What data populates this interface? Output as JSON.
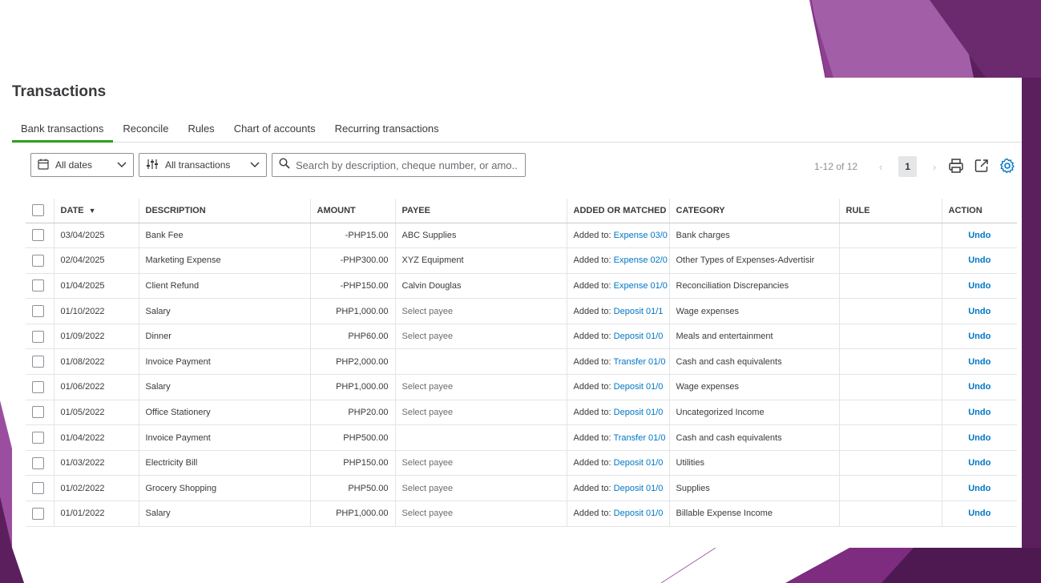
{
  "page": {
    "title": "Transactions"
  },
  "tabs": [
    {
      "label": "Bank transactions",
      "active": true
    },
    {
      "label": "Reconcile"
    },
    {
      "label": "Rules"
    },
    {
      "label": "Chart of accounts"
    },
    {
      "label": "Recurring transactions"
    }
  ],
  "filters": {
    "dates": "All dates",
    "transactions": "All transactions",
    "search_placeholder": "Search by description, cheque number, or amo..."
  },
  "pager": {
    "range": "1-12 of 12",
    "page": "1"
  },
  "icons": {
    "calendar": "calendar-icon",
    "filter": "sliders-icon",
    "search": "search-icon",
    "print": "print-icon",
    "export": "export-icon",
    "settings": "gear-icon"
  },
  "colors": {
    "accent_green": "#2ca01c",
    "link_blue": "#0077c5",
    "settings_blue": "#0077c5"
  },
  "table": {
    "headers": {
      "date": "DATE",
      "description": "DESCRIPTION",
      "amount": "AMOUNT",
      "payee": "PAYEE",
      "added": "ADDED OR MATCHED",
      "category": "CATEGORY",
      "rule": "RULE",
      "action": "ACTION"
    },
    "rows": [
      {
        "date": "03/04/2025",
        "description": "Bank Fee",
        "amount": "-PHP15.00",
        "payee": "ABC Supplies",
        "added_prefix": "Added to:",
        "added_link": "Expense 03/0",
        "category": "Bank charges",
        "rule": "",
        "action": "Undo"
      },
      {
        "date": "02/04/2025",
        "description": "Marketing Expense",
        "amount": "-PHP300.00",
        "payee": "XYZ Equipment",
        "added_prefix": "Added to:",
        "added_link": "Expense 02/0",
        "category": "Other Types of Expenses-Advertisir",
        "rule": "",
        "action": "Undo"
      },
      {
        "date": "01/04/2025",
        "description": "Client Refund",
        "amount": "-PHP150.00",
        "payee": "Calvin Douglas",
        "added_prefix": "Added to:",
        "added_link": "Expense 01/0",
        "category": "Reconciliation Discrepancies",
        "rule": "",
        "action": "Undo"
      },
      {
        "date": "01/10/2022",
        "description": "Salary",
        "amount": "PHP1,000.00",
        "payee": "Select payee",
        "added_prefix": "Added to:",
        "added_link": "Deposit 01/1",
        "category": "Wage expenses",
        "rule": "",
        "action": "Undo"
      },
      {
        "date": "01/09/2022",
        "description": "Dinner",
        "amount": "PHP60.00",
        "payee": "Select payee",
        "added_prefix": "Added to:",
        "added_link": "Deposit 01/0",
        "category": "Meals and entertainment",
        "rule": "",
        "action": "Undo"
      },
      {
        "date": "01/08/2022",
        "description": "Invoice Payment",
        "amount": "PHP2,000.00",
        "payee": "",
        "added_prefix": "Added to:",
        "added_link": "Transfer 01/0",
        "category": "Cash and cash equivalents",
        "rule": "",
        "action": "Undo"
      },
      {
        "date": "01/06/2022",
        "description": "Salary",
        "amount": "PHP1,000.00",
        "payee": "Select payee",
        "added_prefix": "Added to:",
        "added_link": "Deposit 01/0",
        "category": "Wage expenses",
        "rule": "",
        "action": "Undo"
      },
      {
        "date": "01/05/2022",
        "description": "Office Stationery",
        "amount": "PHP20.00",
        "payee": "Select payee",
        "added_prefix": "Added to:",
        "added_link": "Deposit 01/0",
        "category": "Uncategorized Income",
        "rule": "",
        "action": "Undo"
      },
      {
        "date": "01/04/2022",
        "description": "Invoice Payment",
        "amount": "PHP500.00",
        "payee": "",
        "added_prefix": "Added to:",
        "added_link": "Transfer 01/0",
        "category": "Cash and cash equivalents",
        "rule": "",
        "action": "Undo"
      },
      {
        "date": "01/03/2022",
        "description": "Electricity Bill",
        "amount": "PHP150.00",
        "payee": "Select payee",
        "added_prefix": "Added to:",
        "added_link": "Deposit 01/0",
        "category": "Utilities",
        "rule": "",
        "action": "Undo"
      },
      {
        "date": "01/02/2022",
        "description": "Grocery Shopping",
        "amount": "PHP50.00",
        "payee": "Select payee",
        "added_prefix": "Added to:",
        "added_link": "Deposit 01/0",
        "category": "Supplies",
        "rule": "",
        "action": "Undo"
      },
      {
        "date": "01/01/2022",
        "description": "Salary",
        "amount": "PHP1,000.00",
        "payee": "Select payee",
        "added_prefix": "Added to:",
        "added_link": "Deposit 01/0",
        "category": "Billable Expense Income",
        "rule": "",
        "action": "Undo"
      }
    ]
  }
}
